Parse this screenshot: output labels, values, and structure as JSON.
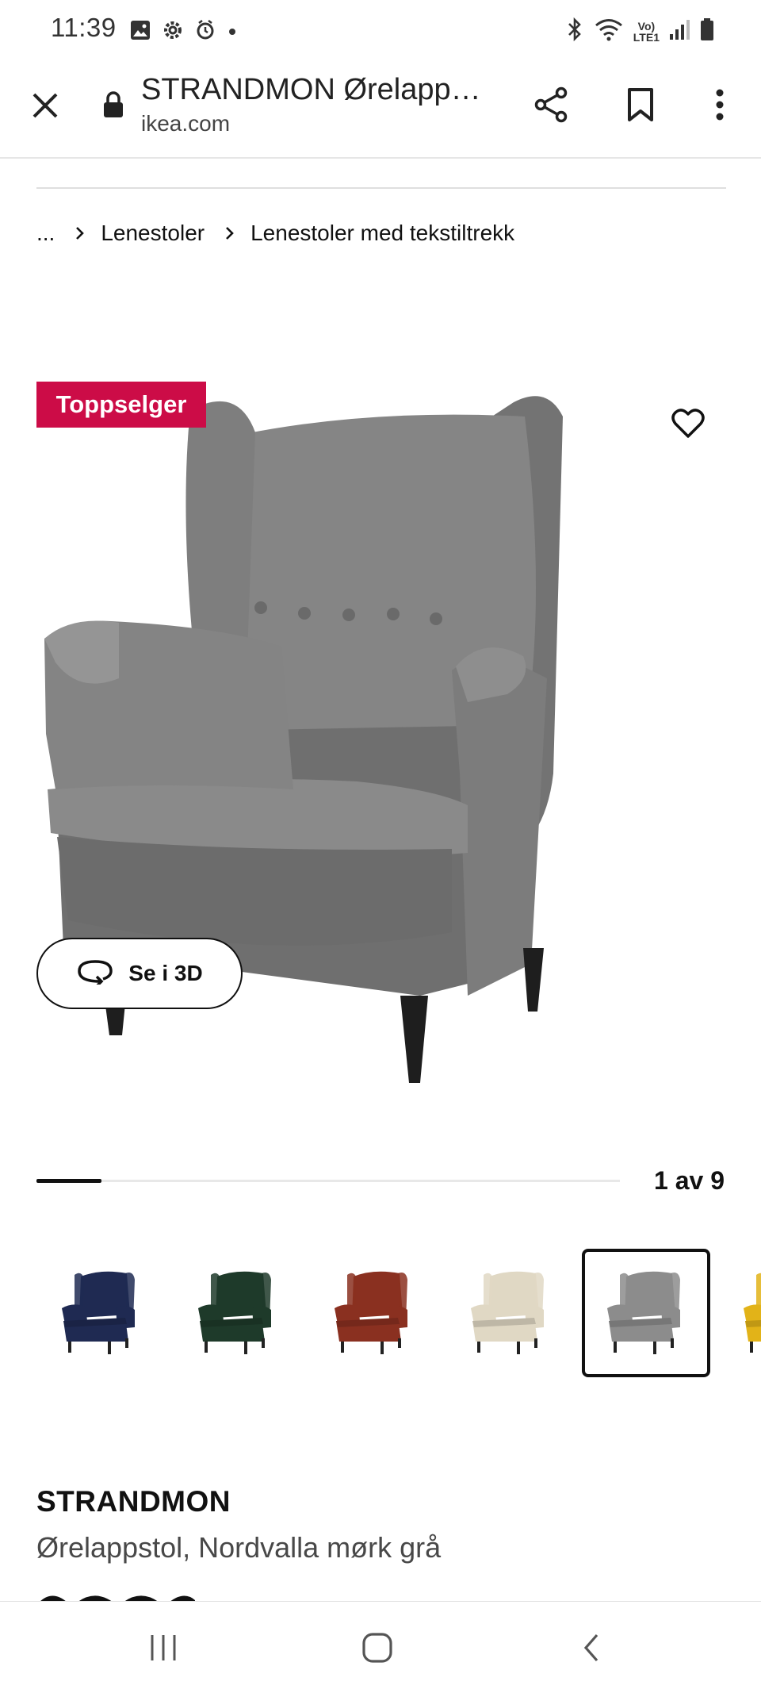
{
  "status_bar": {
    "time": "11:39",
    "left_icons": [
      "image-icon",
      "settings-icon",
      "alarm-icon",
      "dot-icon"
    ],
    "right_icons": [
      "bluetooth-icon",
      "wifi-icon",
      "volte-icon",
      "signal-icon",
      "battery-icon"
    ],
    "volte_line1": "Vo)",
    "volte_line2": "LTE1"
  },
  "browser": {
    "page_title": "STRANDMON Ørelapp…",
    "url": "ikea.com",
    "icons": [
      "close-icon",
      "lock-icon",
      "share-icon",
      "bookmark-icon",
      "more-vert-icon"
    ]
  },
  "breadcrumb": {
    "items": [
      "...",
      "Lenestoler",
      "Lenestoler med tekstiltrekk"
    ]
  },
  "gallery": {
    "badge": "Toppselger",
    "badge_color": "#cc0c47",
    "view_3d_label": "Se i 3D",
    "current_index": 1,
    "total": 9,
    "counter_text": "1 av 9",
    "thumbnails": [
      {
        "color": "#1f2a52",
        "name": "navy"
      },
      {
        "color": "#1e3a2a",
        "name": "dark-green"
      },
      {
        "color": "#8a3020",
        "name": "rust"
      },
      {
        "color": "#e0d8c4",
        "name": "beige"
      },
      {
        "color": "#8c8c8c",
        "name": "grey",
        "selected": true
      },
      {
        "color": "#e2b318",
        "name": "yellow"
      }
    ]
  },
  "product": {
    "name": "STRANDMON",
    "description": "Ørelappstol, Nordvalla mørk grå"
  },
  "nav_bar": {
    "icons": [
      "recent-apps-icon",
      "home-icon",
      "back-icon"
    ]
  }
}
